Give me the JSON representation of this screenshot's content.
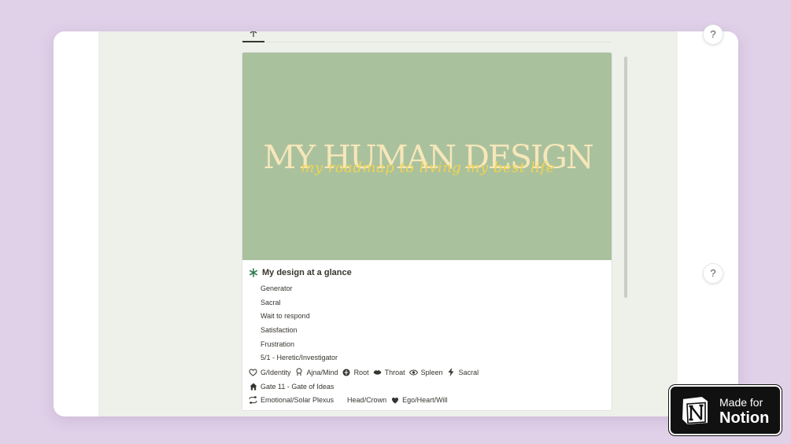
{
  "cover": {
    "title": "MY HUMAN DESIGN",
    "subtitle": "my roadmap to living my best life"
  },
  "callout": {
    "icon": "asterisk-icon",
    "title": "My design at a glance",
    "items": [
      "Generator",
      "Sacral",
      "Wait to respond",
      "Satisfaction",
      "Frustration",
      "5/1 - Heretic/Investigator"
    ],
    "centers": [
      "G/Identity",
      "Ajna/Mind",
      "Root",
      "Throat",
      "Spleen",
      "Sacral"
    ],
    "gate": "Gate 11 - Gate of Ideas",
    "authority": [
      "Emotional/Solar Plexus",
      "Head/Crown",
      "Ego/Heart/Will"
    ]
  },
  "help": {
    "label": "?"
  },
  "badge": {
    "line1": "Made for",
    "line2": "Notion"
  },
  "colors": {
    "background": "#e0d0e8",
    "cover": "#aac19e",
    "title": "#f6e7b9",
    "script": "#f0d44f",
    "accent": "#2f7d4f"
  }
}
